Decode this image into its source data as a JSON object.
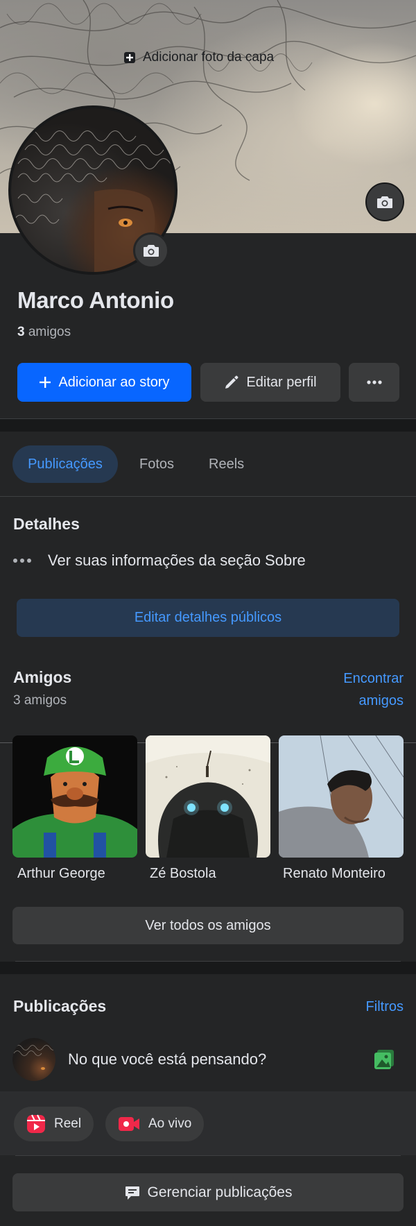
{
  "cover": {
    "add_photo_label": "Adicionar foto da capa"
  },
  "profile": {
    "name": "Marco Antonio",
    "friends_count": "3",
    "friends_suffix": "amigos",
    "add_story_label": "Adicionar ao story",
    "edit_profile_label": "Editar perfil"
  },
  "tabs": [
    {
      "label": "Publicações",
      "active": true
    },
    {
      "label": "Fotos",
      "active": false
    },
    {
      "label": "Reels",
      "active": false
    }
  ],
  "details": {
    "title": "Detalhes",
    "about_text": "Ver suas informações da seção Sobre",
    "edit_public_label": "Editar detalhes públicos"
  },
  "friends": {
    "title": "Amigos",
    "count_text": "3 amigos",
    "find_line1": "Encontrar",
    "find_line2": "amigos",
    "list": [
      {
        "name": "Arthur George"
      },
      {
        "name": "Zé Bostola"
      },
      {
        "name": "Renato Monteiro"
      }
    ],
    "see_all_label": "Ver todos os amigos"
  },
  "posts": {
    "title": "Publicações",
    "filters_label": "Filtros",
    "composer_placeholder": "No que você está pensando?",
    "reel_label": "Reel",
    "live_label": "Ao vivo",
    "manage_label": "Gerenciar publicações"
  },
  "colors": {
    "background": "#242526",
    "primary": "#0866ff",
    "link": "#4599ff",
    "secondary_button": "#3a3b3c",
    "reel_icon": "#f02849",
    "live_icon": "#f02849",
    "photo_icon": "#45bd62"
  }
}
